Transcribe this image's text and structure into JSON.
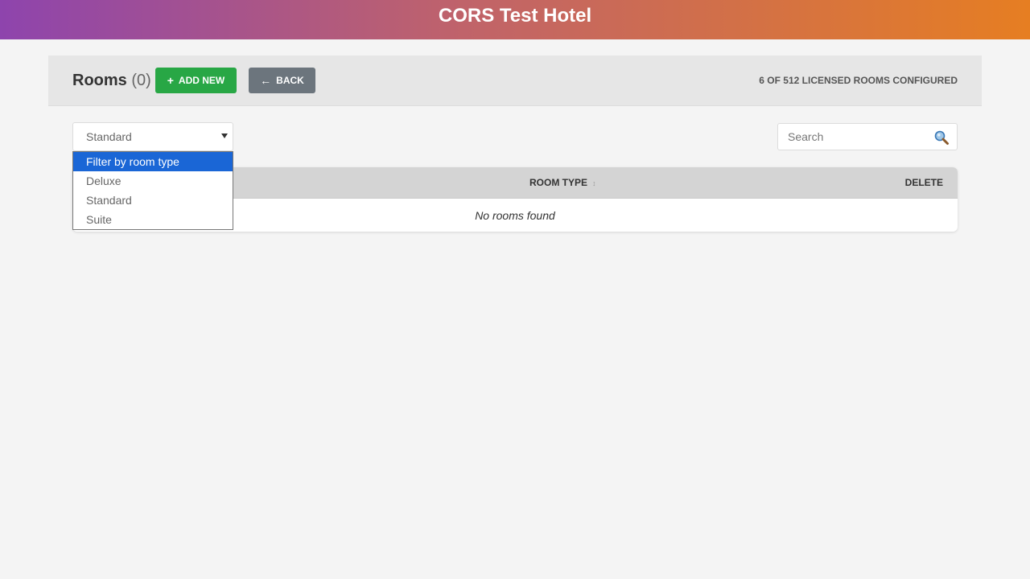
{
  "app": {
    "title": "CORS Test Hotel"
  },
  "header": {
    "rooms_label": "Rooms",
    "rooms_count": "(0)",
    "add_new_icon": "+",
    "add_new_label": "ADD NEW",
    "back_icon": "←",
    "back_label": "BACK",
    "licensed_text": "6 OF 512 LICENSED ROOMS CONFIGURED"
  },
  "filter": {
    "selected_value": "Standard",
    "options": [
      "Filter by room type",
      "Deluxe",
      "Standard",
      "Suite"
    ],
    "highlighted_option": "Filter by room type"
  },
  "search": {
    "placeholder": "Search",
    "value": "",
    "icon": "search-icon"
  },
  "table": {
    "columns": {
      "room_type": "ROOM TYPE",
      "sort_indicator": "↕",
      "delete": "DELETE"
    },
    "empty_message": "No rooms found"
  },
  "colors": {
    "gradient_start": "#8e44ad",
    "gradient_end": "#e67e22",
    "add_button": "#28a745",
    "back_button": "#6c757d",
    "dropdown_highlight": "#1a66d6"
  }
}
